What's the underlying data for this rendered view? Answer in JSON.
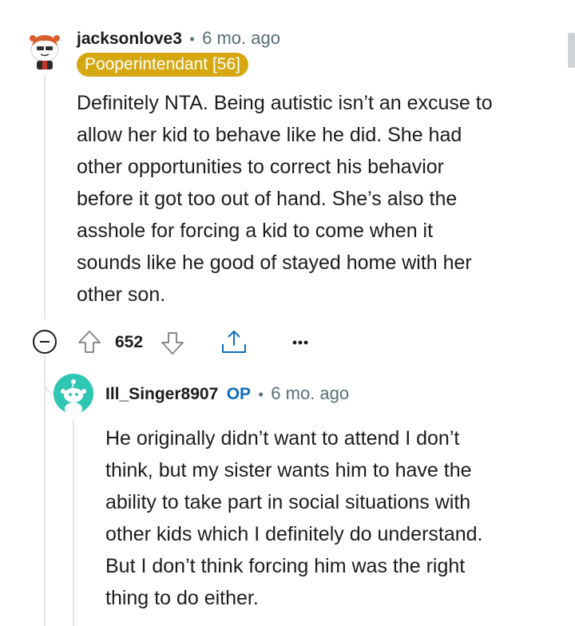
{
  "comment": {
    "username": "jacksonlove3",
    "separator": "•",
    "time": "6 mo. ago",
    "flair": "Pooperintendant [56]",
    "lines": [
      "Definitely NTA. Being autistic isn’t an excuse to",
      "allow her kid to behave like he did. She had",
      "other opportunities to correct his behavior",
      "before it got too out of hand. She’s also the",
      "asshole for forcing a kid to come when it",
      "sounds like he good of stayed home with her",
      "other son."
    ],
    "score": "652"
  },
  "reply": {
    "username": "Ill_Singer8907",
    "op_badge": "OP",
    "separator": "•",
    "time": "6 mo. ago",
    "lines": [
      "He originally didn’t want to attend I don’t",
      "think, but my sister wants him to have the",
      "ability to take part in social situations with",
      "other kids which I definitely do understand.",
      "But I don’t think forcing him was the right",
      "thing to do either."
    ]
  },
  "icons": {
    "collapse": "collapse-minus-icon",
    "upvote": "upvote-arrow-icon",
    "downvote": "downvote-arrow-icon",
    "share": "share-icon",
    "more": "more-options-icon"
  },
  "colors": {
    "flair_bg": "#d5a812",
    "op_blue": "#0f6cbd",
    "meta_gray": "#576f76",
    "reply_avatar_bg": "#2fc7b4"
  }
}
